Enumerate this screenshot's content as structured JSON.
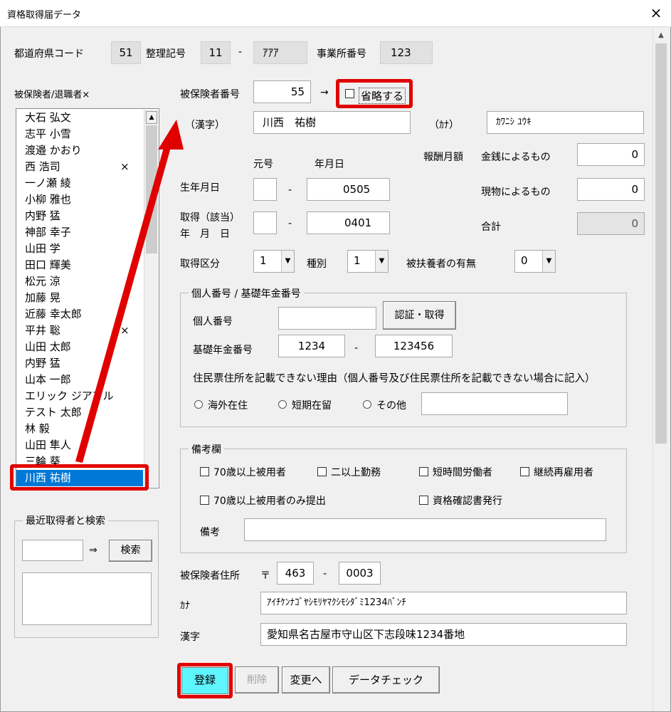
{
  "window": {
    "title": "資格取得届データ",
    "close": "×"
  },
  "header": {
    "pref_code_label": "都道府県コード",
    "pref_code_value": "51",
    "seiri_label": "整理記号",
    "seiri_value1": "11",
    "seiri_dash": "-",
    "seiri_value2": "ｱｱｱ",
    "office_no_label": "事業所番号",
    "office_no_value": "123"
  },
  "employee_list": {
    "label": "被保険者/退職者×",
    "items": [
      {
        "name": "大石 弘文",
        "mark": ""
      },
      {
        "name": "志平 小雪",
        "mark": ""
      },
      {
        "name": "渡邉 かおり",
        "mark": ""
      },
      {
        "name": "西 浩司",
        "mark": "×"
      },
      {
        "name": "一ノ瀬 綾",
        "mark": ""
      },
      {
        "name": "小柳 雅也",
        "mark": ""
      },
      {
        "name": "内野 猛",
        "mark": ""
      },
      {
        "name": "神部 幸子",
        "mark": ""
      },
      {
        "name": "山田 学",
        "mark": ""
      },
      {
        "name": "田口 輝美",
        "mark": ""
      },
      {
        "name": "松元 涼",
        "mark": ""
      },
      {
        "name": "加藤 晃",
        "mark": ""
      },
      {
        "name": "近藤 幸太郎",
        "mark": ""
      },
      {
        "name": "平井 聡",
        "mark": "×"
      },
      {
        "name": "山田 太郎",
        "mark": ""
      },
      {
        "name": "内野 猛",
        "mark": ""
      },
      {
        "name": "山本 一郎",
        "mark": ""
      },
      {
        "name": "エリック ジアアル",
        "mark": ""
      },
      {
        "name": "テスト 太郎",
        "mark": ""
      },
      {
        "name": "林 毅",
        "mark": ""
      },
      {
        "name": "山田 隼人",
        "mark": ""
      },
      {
        "name": "三輪 葵",
        "mark": ""
      }
    ],
    "selected": "川西 祐樹"
  },
  "recent_search": {
    "label": "最近取得者と検索",
    "input_value": "",
    "arrow": "⇒",
    "search_button": "検索"
  },
  "insured": {
    "number_label": "被保険者番号",
    "number_value": "55",
    "arrow": "→",
    "omit_label": "省略する",
    "kanji_label": "（漢字）",
    "kanji_value": "川西　祐樹",
    "kana_label": "（ｶﾅ）",
    "kana_value": "ｶﾜﾆｼ ﾕｳｷ",
    "gengo_label": "元号",
    "ymd_label": "年月日",
    "birth_label": "生年月日",
    "birth_gengo": "",
    "birth_dash": "-",
    "birth_date": "0505",
    "acq_label_1": "取得（該当）",
    "acq_label_2": "年　月　日",
    "acq_gengo": "",
    "acq_dash": "-",
    "acq_date": "0401",
    "acq_type_label": "取得区分",
    "acq_type_value": "1",
    "kind_label": "種別",
    "kind_value": "1",
    "dependent_label": "被扶養者の有無",
    "dependent_value": "0"
  },
  "salary": {
    "label": "報酬月額",
    "cash_label": "金銭によるもの",
    "cash_value": "0",
    "goods_label": "現物によるもの",
    "goods_value": "0",
    "total_label": "合計",
    "total_value": "0"
  },
  "personal_number": {
    "frame_label": "個人番号 / 基礎年金番号",
    "my_number_label": "個人番号",
    "my_number_value": "",
    "auth_button": "認証・取得",
    "pension_label": "基礎年金番号",
    "pension_value1": "1234",
    "pension_dash": "-",
    "pension_value2": "123456",
    "reason_text": "住民票住所を記載できない理由（個人番号及び住民票住所を記載できない場合に記入）",
    "radio_overseas": "海外在住",
    "radio_short": "短期在留",
    "radio_other": "その他",
    "other_value": ""
  },
  "remarks": {
    "frame_label": "備考欄",
    "chk_70": "70歳以上被用者",
    "chk_two": "二以上勤務",
    "chk_short": "短時間労働者",
    "chk_rehire": "継続再雇用者",
    "chk_70only": "70歳以上被用者のみ提出",
    "chk_cert": "資格確認書発行",
    "note_label": "備考",
    "note_value": ""
  },
  "address": {
    "label": "被保険者住所",
    "postal_mark": "〒",
    "postal1": "463",
    "postal_dash": "-",
    "postal2": "0003",
    "kana_label": "ｶﾅ",
    "kana_value": "ｱｲﾁｹﾝﾅｺﾞﾔｼﾓﾘﾔﾏｸｼﾓｼﾀﾞﾐ1234ﾊﾞﾝﾁ",
    "kanji_label": "漢字",
    "kanji_value": "愛知県名古屋市守山区下志段味1234番地"
  },
  "footer": {
    "register": "登録",
    "delete": "削除",
    "change": "変更へ",
    "data_check": "データチェック"
  },
  "colors": {
    "highlight": "#e00000",
    "selection": "#0078d7",
    "register_bg": "#5ff5ff"
  }
}
